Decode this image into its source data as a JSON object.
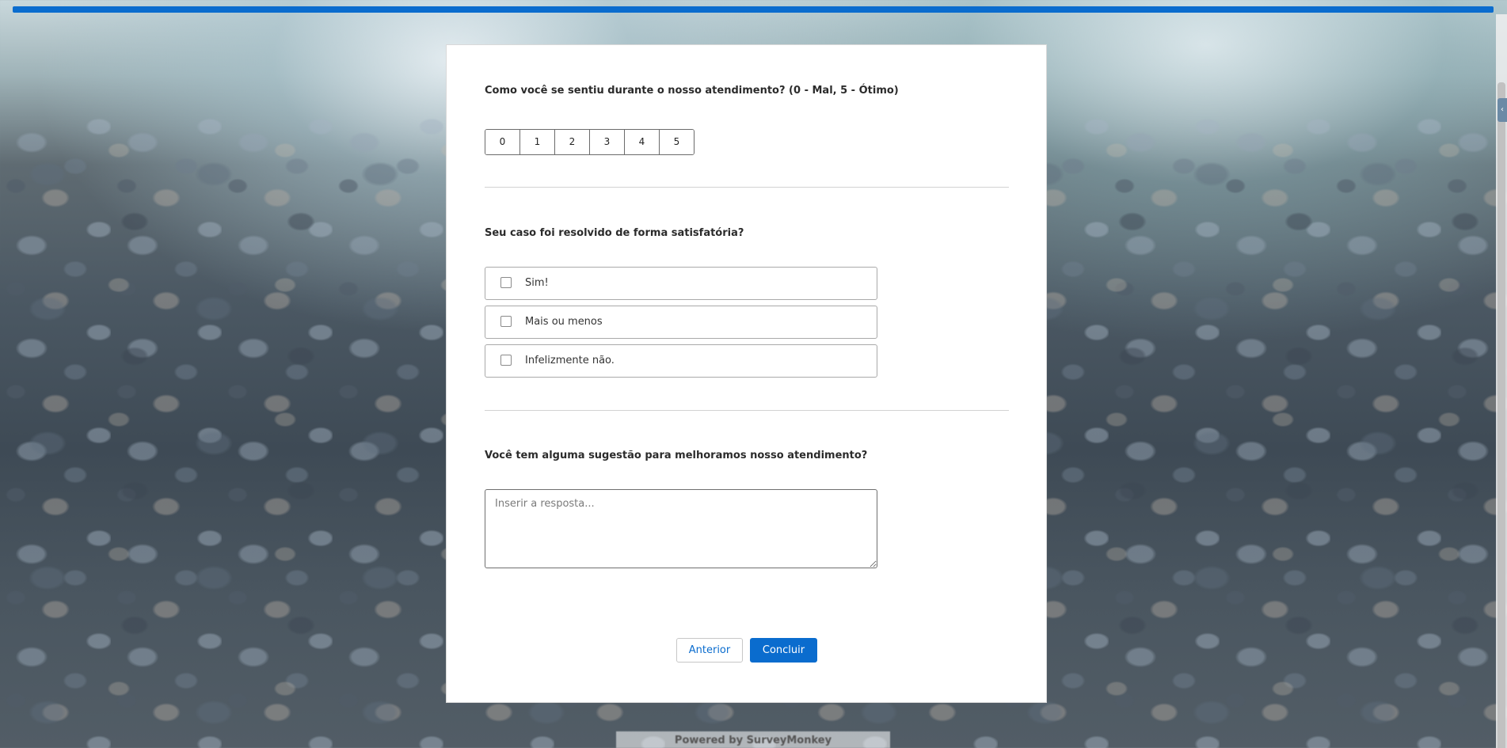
{
  "colors": {
    "accent": "#0a6cce",
    "card_background": "#ffffff"
  },
  "survey": {
    "q1": {
      "text": "Como você se sentiu durante o nosso atendimento? (0 - Mal, 5 - Ótimo)",
      "scale": [
        "0",
        "1",
        "2",
        "3",
        "4",
        "5"
      ]
    },
    "q2": {
      "text": "Seu caso foi resolvido de forma satisfatória?",
      "options": [
        "Sim!",
        "Mais ou menos",
        "Infelizmente não."
      ]
    },
    "q3": {
      "text": "Você tem alguma sugestão para melhoramos nosso atendimento?",
      "placeholder": "Inserir a resposta..."
    }
  },
  "buttons": {
    "previous": "Anterior",
    "finish": "Concluir"
  },
  "footer": {
    "powered_by": "Powered by SurveyMonkey"
  }
}
